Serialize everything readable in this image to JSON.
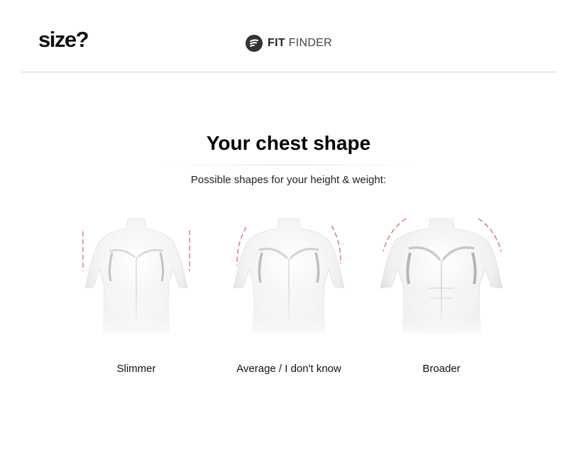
{
  "header": {
    "logo": "size?",
    "fit_finder_strong": "FIT",
    "fit_finder_light": "FINDER",
    "icon": "fit-finder-icon"
  },
  "main": {
    "title": "Your chest shape",
    "subtitle": "Possible shapes for your height & weight:",
    "options": [
      {
        "label": "Slimmer",
        "icon": "slim-torso-icon"
      },
      {
        "label": "Average / I don't know",
        "icon": "average-torso-icon"
      },
      {
        "label": "Broader",
        "icon": "broad-torso-icon"
      }
    ]
  },
  "colors": {
    "accent_dashes": "#e05555",
    "divider": "#cfcfcf",
    "text": "#111111"
  }
}
